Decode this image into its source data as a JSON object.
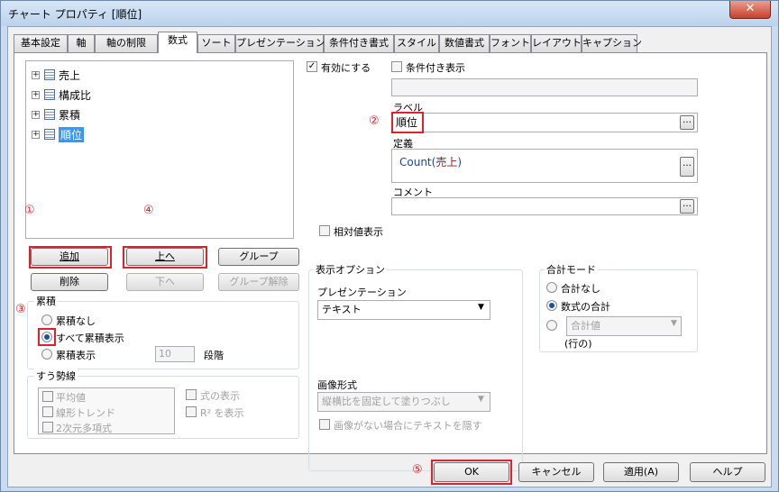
{
  "window": {
    "title": "チャート プロパティ [順位]",
    "close_glyph": "✕"
  },
  "tabs": [
    "基本設定",
    "軸",
    "軸の制限",
    "数式",
    "ソート",
    "プレゼンテーション",
    "条件付き書式",
    "スタイル",
    "数値書式",
    "フォント",
    "レイアウト",
    "キャプション"
  ],
  "tree": {
    "items": [
      "売上",
      "構成比",
      "累積",
      "順位"
    ],
    "expand_glyph": "+"
  },
  "left_buttons": {
    "add": "追加",
    "up": "上へ",
    "group": "グループ",
    "delete": "削除",
    "down": "下へ",
    "ungroup": "グループ解除"
  },
  "cumulative": {
    "title": "累積",
    "none": "累積なし",
    "all": "すべて累積表示",
    "show": "累積表示",
    "steps_value": "10",
    "steps_label": "段階",
    "selected": "all"
  },
  "trendline": {
    "title": "すう勢線",
    "items": [
      "平均値",
      "線形トレンド",
      "2次元多項式"
    ],
    "show_formula": "式の表示",
    "show_r2": "R² を表示"
  },
  "right": {
    "enable": "有効にする",
    "enable_checked": true,
    "conditional": "条件付き表示",
    "label_title": "ラベル",
    "label_value": "順位",
    "definition_title": "定義",
    "definition_func": "Count",
    "definition_arg": "売上",
    "comment_title": "コメント",
    "relative": "相対値表示"
  },
  "display_options": {
    "title": "表示オプション",
    "presentation_label": "プレゼンテーション",
    "presentation_value": "テキスト",
    "image_label": "画像形式",
    "image_value": "縦横比を固定して塗りつぶし",
    "hide_text": "画像がない場合にテキストを隠す"
  },
  "total_mode": {
    "title": "合計モード",
    "none": "合計なし",
    "formula_total": "数式の合計",
    "total_value": "合計値",
    "rows": "(行の)",
    "selected": "formula_total"
  },
  "footer": {
    "ok": "OK",
    "cancel": "キャンセル",
    "apply": "適用(A)",
    "help": "ヘルプ"
  },
  "annotations": [
    "①",
    "②",
    "③",
    "④",
    "⑤"
  ],
  "colors": {
    "highlight": "#e0202a",
    "selection": "#3399ff",
    "link_blue": "#1f3fc0"
  }
}
